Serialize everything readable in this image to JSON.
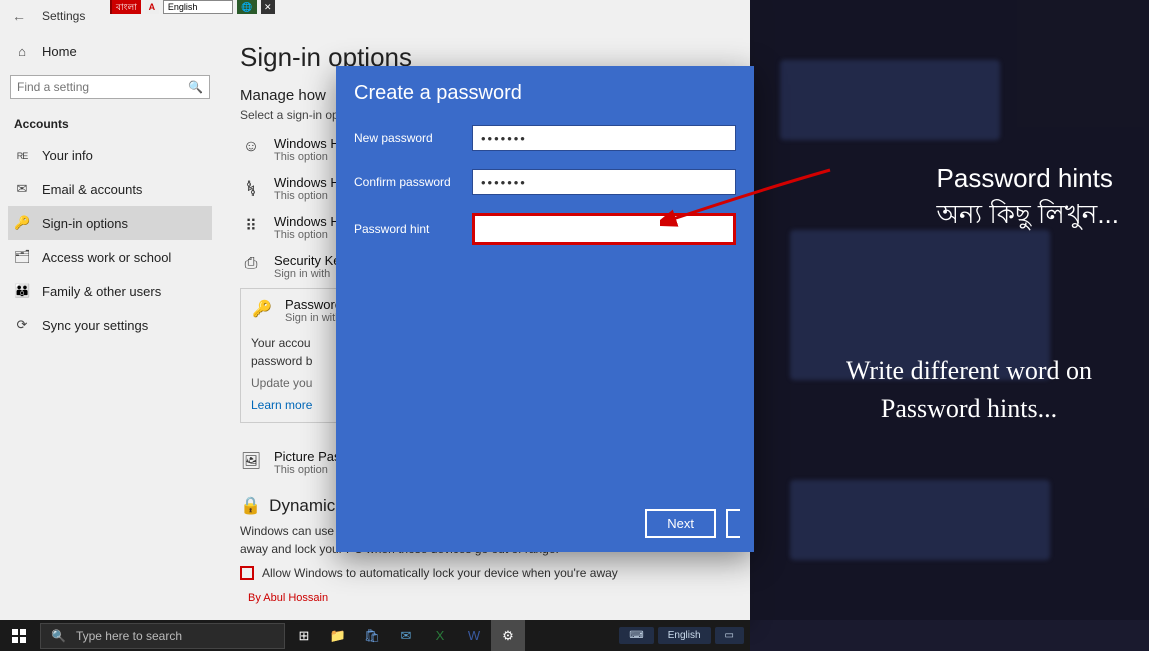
{
  "top_strip": {
    "bangla": "বাংলা",
    "english": "English"
  },
  "titlebar": {
    "title": "Settings"
  },
  "sidebar": {
    "home": "Home",
    "search_placeholder": "Find a setting",
    "section": "Accounts",
    "items": [
      {
        "icon": "RE",
        "label": "Your info"
      },
      {
        "icon": "✉",
        "label": "Email & accounts"
      },
      {
        "icon": "🔑",
        "label": "Sign-in options"
      },
      {
        "icon": "🗂",
        "label": "Access work or school"
      },
      {
        "icon": "👪",
        "label": "Family & other users"
      },
      {
        "icon": "⟳",
        "label": "Sync your settings"
      }
    ]
  },
  "content": {
    "heading": "Sign-in options",
    "subheading": "Manage how",
    "helper": "Select a sign-in opt",
    "options": [
      {
        "icon": "☺",
        "title": "Windows H",
        "sub": "This option"
      },
      {
        "icon": "𖣩",
        "title": "Windows H",
        "sub": "This option"
      },
      {
        "icon": "⠿",
        "title": "Windows H",
        "sub": "This option"
      },
      {
        "icon": "⎙",
        "title": "Security Ke",
        "sub": "Sign in with"
      }
    ],
    "password_option": {
      "icon": "🔑",
      "title": "Password",
      "sub": "Sign in with"
    },
    "account_msg": "Your accou\npassword b",
    "update_link": "Update you",
    "learn_link": "Learn more",
    "picture": {
      "icon": "🖼",
      "title": "Picture Pass",
      "sub": "This option"
    },
    "dynamic_heading": "Dynamic",
    "dynamic_text": "Windows can use devices that are paired to your PC to know when you're away and lock your PC when those devices go out of range.",
    "checkbox_label": "Allow Windows to automatically lock your device when you're away",
    "credit": "By Abul Hossain"
  },
  "modal": {
    "title": "Create a password",
    "new_label": "New password",
    "new_value": "•••••••",
    "confirm_label": "Confirm password",
    "confirm_value": "•••••••",
    "hint_label": "Password hint",
    "hint_value": "",
    "next_btn": "Next"
  },
  "overlay": {
    "line1a": "Password hints",
    "line1b": "অন্য কিছু লিখুন...",
    "line2": "Write different word on Password hints..."
  },
  "taskbar": {
    "search_placeholder": "Type here to search",
    "lang": "English"
  }
}
